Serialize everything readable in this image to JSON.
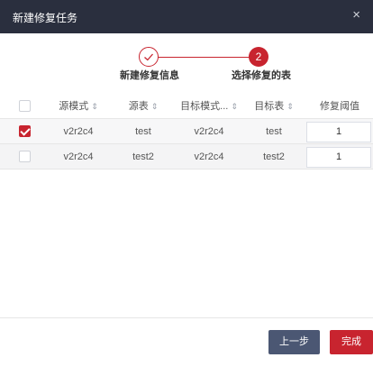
{
  "dialog": {
    "title": "新建修复任务",
    "close": "×"
  },
  "steps": [
    {
      "number": "✓",
      "label": "新建修复信息"
    },
    {
      "number": "2",
      "label": "选择修复的表"
    }
  ],
  "table": {
    "sort_icon": "⇕",
    "columns": [
      "源模式",
      "源表",
      "目标模式...",
      "目标表",
      "修复阈值"
    ],
    "rows": [
      {
        "checked": true,
        "source_schema": "v2r2c4",
        "source_table": "test",
        "target_schema": "v2r2c4",
        "target_table": "test",
        "threshold": "1"
      },
      {
        "checked": false,
        "source_schema": "v2r2c4",
        "source_table": "test2",
        "target_schema": "v2r2c4",
        "target_table": "test2",
        "threshold": "1"
      }
    ]
  },
  "footer": {
    "prev_label": "上一步",
    "done_label": "完成"
  },
  "colors": {
    "accent": "#c8242f",
    "header_bg": "#2a2f3e",
    "secondary_button": "#4b5773"
  }
}
